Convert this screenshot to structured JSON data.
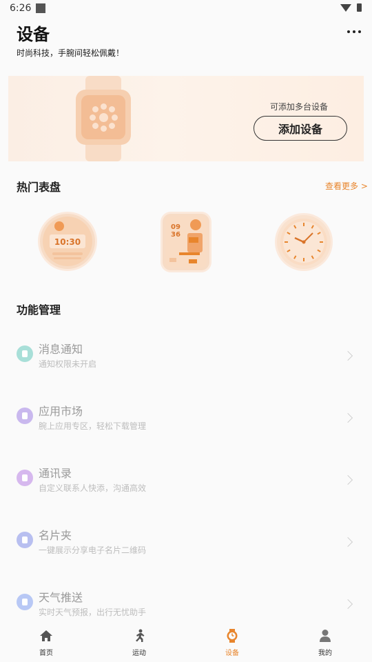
{
  "status_bar": {
    "time": "6:26"
  },
  "header": {
    "title": "设备",
    "subtitle": "时尚科技，手腕间轻松佩戴！"
  },
  "banner": {
    "hint": "可添加多台设备",
    "add_button": "添加设备"
  },
  "watch_faces": {
    "title": "热门表盘",
    "see_more": "查看更多 >",
    "face1_time": "10:30",
    "face2_hour": "09",
    "face2_minute": "36"
  },
  "functions": {
    "title": "功能管理",
    "items": [
      {
        "name": "消息通知",
        "desc": "通知权限未开启",
        "icon": "bell-icon",
        "color": "#a8dfd8"
      },
      {
        "name": "应用市场",
        "desc": "腕上应用专区，轻松下载管理",
        "icon": "shopping-bag-icon",
        "color": "#c9b8ee"
      },
      {
        "name": "通讯录",
        "desc": "自定义联系人快添，沟通高效",
        "icon": "contacts-icon",
        "color": "#d6b8ee"
      },
      {
        "name": "名片夹",
        "desc": "一键展示分享电子名片二维码",
        "icon": "card-icon",
        "color": "#b8bff0"
      },
      {
        "name": "天气推送",
        "desc": "实时天气预报，出行无忧助手",
        "icon": "cloud-icon",
        "color": "#b8c8f5"
      }
    ]
  },
  "nav": {
    "items": [
      {
        "label": "首页",
        "icon": "home-icon"
      },
      {
        "label": "运动",
        "icon": "running-icon"
      },
      {
        "label": "设备",
        "icon": "watch-icon"
      },
      {
        "label": "我的",
        "icon": "user-icon"
      }
    ],
    "active_index": 2,
    "active_color": "#e8852c"
  }
}
